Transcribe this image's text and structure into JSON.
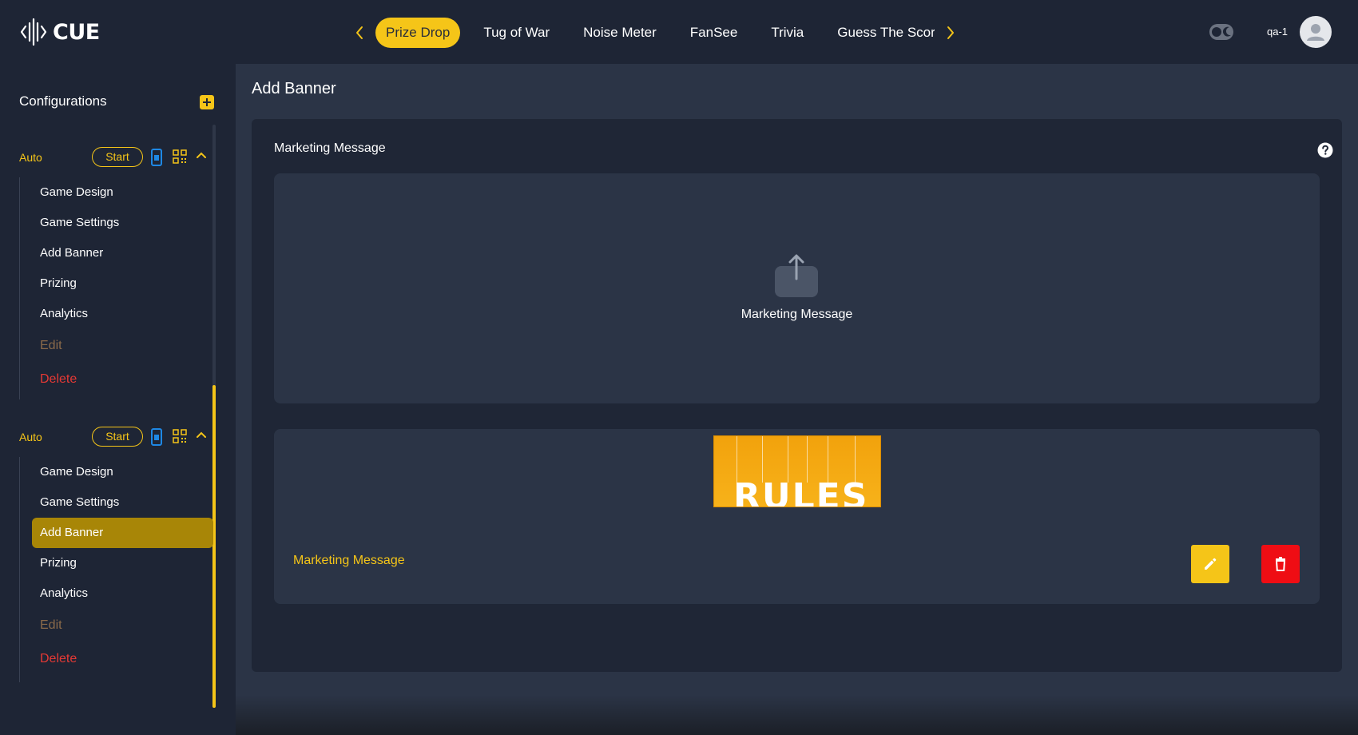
{
  "app": {
    "logo_text": "CUE",
    "user_name": "qa-1"
  },
  "nav": {
    "tabs": [
      "Prize Drop",
      "Tug of War",
      "Noise Meter",
      "FanSee",
      "Trivia",
      "Guess The Score"
    ],
    "active_tab": "Prize Drop"
  },
  "sidebar": {
    "title": "Configurations",
    "configs": [
      {
        "label": "Auto",
        "start_label": "Start",
        "items": [
          "Game Design",
          "Game Settings",
          "Add Banner",
          "Prizing",
          "Analytics"
        ],
        "edit_label": "Edit",
        "delete_label": "Delete"
      },
      {
        "label": "Auto",
        "start_label": "Start",
        "items": [
          "Game Design",
          "Game Settings",
          "Add Banner",
          "Prizing",
          "Analytics"
        ],
        "edit_label": "Edit",
        "delete_label": "Delete",
        "active_item": "Add Banner"
      }
    ]
  },
  "main": {
    "page_title": "Add Banner",
    "section_label": "Marketing Message",
    "upload_label": "Marketing Message",
    "banner": {
      "image_text": "RULES",
      "label": "Marketing Message"
    }
  },
  "colors": {
    "accent": "#f5c518",
    "background": "#1e2535",
    "panel": "#2b3446",
    "danger": "#ef0d14",
    "active_item": "#a88607"
  }
}
